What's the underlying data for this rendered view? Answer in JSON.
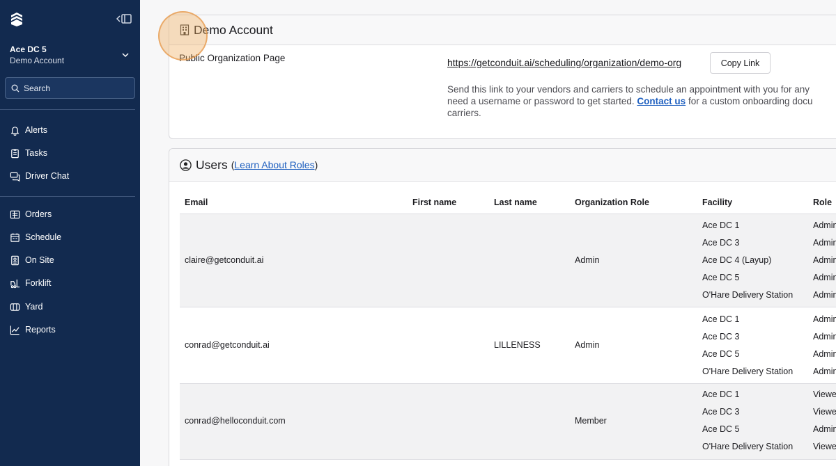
{
  "sidebar": {
    "org_name": "Ace DC 5",
    "org_sub": "Demo Account",
    "search_label": "Search",
    "nav_top": [
      {
        "label": "Alerts",
        "icon": "bell-icon"
      },
      {
        "label": "Tasks",
        "icon": "clipboard-icon"
      },
      {
        "label": "Driver Chat",
        "icon": "chat-icon"
      }
    ],
    "nav_bottom": [
      {
        "label": "Orders",
        "icon": "orders-icon"
      },
      {
        "label": "Schedule",
        "icon": "calendar-icon"
      },
      {
        "label": "On Site",
        "icon": "onsite-icon"
      },
      {
        "label": "Forklift",
        "icon": "forklift-icon"
      },
      {
        "label": "Yard",
        "icon": "yard-icon"
      },
      {
        "label": "Reports",
        "icon": "chart-icon"
      }
    ]
  },
  "org_card": {
    "title": "Demo Account",
    "page_label": "Public Organization Page",
    "link": "https://getconduit.ai/scheduling/organization/demo-org",
    "copy_label": "Copy Link",
    "desc_line1": "Send this link to your vendors and carriers to schedule an appointment with you for any",
    "desc_line2_pre": "need a username or password to get started.",
    "desc_link": "Contact us",
    "desc_line2_post": "for a custom onboarding docu",
    "desc_line3": "carriers."
  },
  "users_card": {
    "title": "Users",
    "paren_open": "(",
    "roles_link": "Learn About Roles",
    "paren_close": ")",
    "headers": {
      "email": "Email",
      "first_name": "First name",
      "last_name": "Last name",
      "org_role": "Organization Role",
      "facility": "Facility",
      "role": "Role"
    },
    "rows": [
      {
        "email": "claire@getconduit.ai",
        "first_name": "",
        "last_name": "",
        "org_role": "Admin",
        "facilities": [
          {
            "name": "Ace DC 1",
            "role": "Admin"
          },
          {
            "name": "Ace DC 3",
            "role": "Admin"
          },
          {
            "name": "Ace DC 4 (Layup)",
            "role": "Admin"
          },
          {
            "name": "Ace DC 5",
            "role": "Admin"
          },
          {
            "name": "O'Hare Delivery Station",
            "role": "Admin"
          }
        ]
      },
      {
        "email": "conrad@getconduit.ai",
        "first_name": "",
        "last_name": "LILLENESS",
        "org_role": "Admin",
        "facilities": [
          {
            "name": "Ace DC 1",
            "role": "Admin"
          },
          {
            "name": "Ace DC 3",
            "role": "Admin"
          },
          {
            "name": "Ace DC 5",
            "role": "Admin"
          },
          {
            "name": "O'Hare Delivery Station",
            "role": "Admin"
          }
        ]
      },
      {
        "email": "conrad@helloconduit.com",
        "first_name": "",
        "last_name": "",
        "org_role": "Member",
        "facilities": [
          {
            "name": "Ace DC 1",
            "role": "Viewe"
          },
          {
            "name": "Ace DC 3",
            "role": "Viewe"
          },
          {
            "name": "Ace DC 5",
            "role": "Admin"
          },
          {
            "name": "O'Hare Delivery Station",
            "role": "Viewe"
          }
        ]
      }
    ]
  },
  "colors": {
    "sidebar_bg": "#122a4f",
    "link": "#1e5fbf",
    "highlight": "#f0aa5a"
  }
}
